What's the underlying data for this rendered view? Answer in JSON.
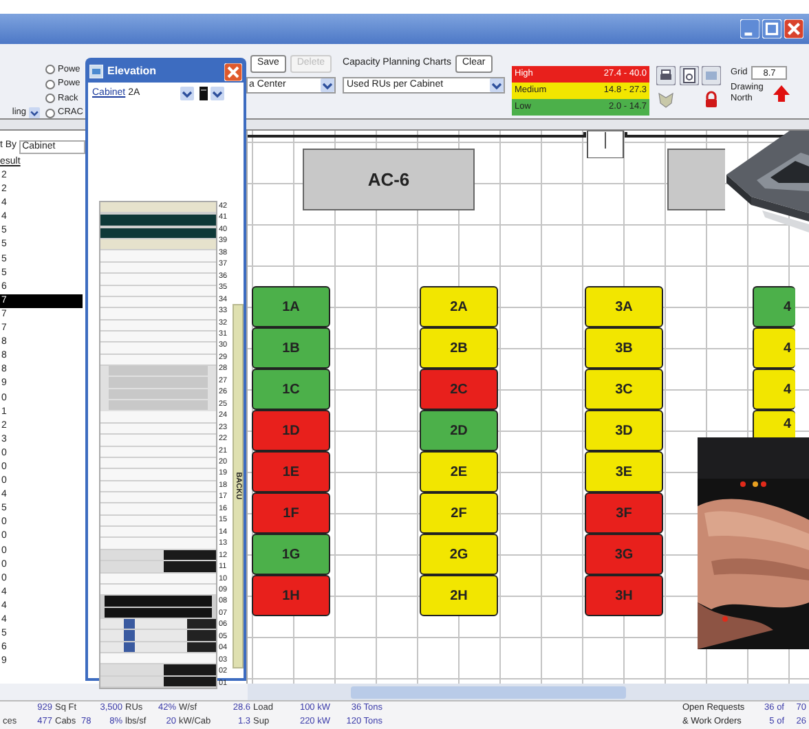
{
  "filters": {
    "radios": [
      {
        "label": "Powe",
        "selected": false
      },
      {
        "label": "Powe",
        "selected": false
      },
      {
        "label": "Rack",
        "selected": false
      },
      {
        "label": "CRAC",
        "selected": false
      }
    ],
    "dropdown_label": "ling",
    "sort_label": "t By",
    "sort_value": "Cabinet"
  },
  "result_list": {
    "header": "esult",
    "rows": [
      {
        "text": "2",
        "selected": false
      },
      {
        "text": "2",
        "selected": false
      },
      {
        "text": "4",
        "selected": false
      },
      {
        "text": "4",
        "selected": false
      },
      {
        "text": "5",
        "selected": false
      },
      {
        "text": "5",
        "selected": false
      },
      {
        "text": "5",
        "selected": false
      },
      {
        "text": "5",
        "selected": false
      },
      {
        "text": "6",
        "selected": false
      },
      {
        "text": "7",
        "selected": true
      },
      {
        "text": "7",
        "selected": false
      },
      {
        "text": "7",
        "selected": false
      },
      {
        "text": "8",
        "selected": false
      },
      {
        "text": "8",
        "selected": false
      },
      {
        "text": "8",
        "selected": false
      },
      {
        "text": "9",
        "selected": false
      },
      {
        "text": "0",
        "selected": false
      },
      {
        "text": "1",
        "selected": false
      },
      {
        "text": "2",
        "selected": false
      },
      {
        "text": "3",
        "selected": false
      },
      {
        "text": "0",
        "selected": false
      },
      {
        "text": "0",
        "selected": false
      },
      {
        "text": "0",
        "selected": false
      },
      {
        "text": "4",
        "selected": false
      },
      {
        "text": "5",
        "selected": false
      },
      {
        "text": "0",
        "selected": false
      },
      {
        "text": "0",
        "selected": false
      },
      {
        "text": "0",
        "selected": false
      },
      {
        "text": "0",
        "selected": false
      },
      {
        "text": "0",
        "selected": false
      },
      {
        "text": "4",
        "selected": false
      },
      {
        "text": "4",
        "selected": false
      },
      {
        "text": "4",
        "selected": false
      },
      {
        "text": "5",
        "selected": false
      },
      {
        "text": "6",
        "selected": false
      },
      {
        "text": "9",
        "selected": false
      }
    ]
  },
  "toolbar": {
    "save": "Save",
    "delete": {
      "label": "Delete",
      "disabled": true
    },
    "view_select": "a Center",
    "charts_label": "Capacity Planning Charts",
    "clear": "Clear",
    "chart_select": "Used RUs per Cabinet",
    "legend": [
      {
        "name": "High",
        "range": "27.4 - 40.0",
        "color": "#e8201c"
      },
      {
        "name": "Medium",
        "range": "14.8 - 27.3",
        "color": "#f2e600"
      },
      {
        "name": "Low",
        "range": "2.0 - 14.7",
        "color": "#4cb04a"
      }
    ],
    "grid_label": "Grid",
    "grid_value": "8.7",
    "north_label": "Drawing North"
  },
  "elevation": {
    "title": "Elevation",
    "cabinet_link": "Cabinet",
    "cabinet_value": "2A",
    "side_label": "BACKU",
    "units": [
      {
        "number": "42",
        "kind": "shelf"
      },
      {
        "number": "41",
        "kind": "patch"
      },
      {
        "number": "40",
        "kind": "patch"
      },
      {
        "number": "39",
        "kind": "shelf"
      },
      {
        "number": "38",
        "kind": "empty"
      },
      {
        "number": "37",
        "kind": "empty"
      },
      {
        "number": "36",
        "kind": "empty"
      },
      {
        "number": "35",
        "kind": "empty"
      },
      {
        "number": "34",
        "kind": "empty"
      },
      {
        "number": "33",
        "kind": "empty"
      },
      {
        "number": "32",
        "kind": "empty"
      },
      {
        "number": "31",
        "kind": "empty"
      },
      {
        "number": "30",
        "kind": "empty"
      },
      {
        "number": "29",
        "kind": "empty"
      },
      {
        "number": "28",
        "kind": "server"
      },
      {
        "number": "27",
        "kind": "server"
      },
      {
        "number": "26",
        "kind": "server"
      },
      {
        "number": "25",
        "kind": "server"
      },
      {
        "number": "24",
        "kind": "empty"
      },
      {
        "number": "23",
        "kind": "empty"
      },
      {
        "number": "22",
        "kind": "empty"
      },
      {
        "number": "21",
        "kind": "empty"
      },
      {
        "number": "20",
        "kind": "empty"
      },
      {
        "number": "19",
        "kind": "empty"
      },
      {
        "number": "18",
        "kind": "empty"
      },
      {
        "number": "17",
        "kind": "empty"
      },
      {
        "number": "16",
        "kind": "empty"
      },
      {
        "number": "15",
        "kind": "empty"
      },
      {
        "number": "14",
        "kind": "empty"
      },
      {
        "number": "13",
        "kind": "empty"
      },
      {
        "number": "12",
        "kind": "switch"
      },
      {
        "number": "11",
        "kind": "switch"
      },
      {
        "number": "10",
        "kind": "empty"
      },
      {
        "number": "09",
        "kind": "empty"
      },
      {
        "number": "08",
        "kind": "blade"
      },
      {
        "number": "07",
        "kind": "blade"
      },
      {
        "number": "06",
        "kind": "module"
      },
      {
        "number": "05",
        "kind": "module"
      },
      {
        "number": "04",
        "kind": "module"
      },
      {
        "number": "03",
        "kind": "empty"
      },
      {
        "number": "02",
        "kind": "switch"
      },
      {
        "number": "01",
        "kind": "switch"
      }
    ]
  },
  "floor_plan": {
    "ac_units": [
      {
        "label": "AC-6"
      },
      {
        "kind": "unlabeled"
      }
    ],
    "columns": [
      [
        {
          "label": "1A",
          "color": "#4cb04a"
        },
        {
          "label": "1B",
          "color": "#4cb04a"
        },
        {
          "label": "1C",
          "color": "#4cb04a"
        },
        {
          "label": "1D",
          "color": "#e8201c"
        },
        {
          "label": "1E",
          "color": "#e8201c"
        },
        {
          "label": "1F",
          "color": "#e8201c"
        },
        {
          "label": "1G",
          "color": "#4cb04a"
        },
        {
          "label": "1H",
          "color": "#e8201c"
        }
      ],
      [
        {
          "label": "2A",
          "color": "#f2e600"
        },
        {
          "label": "2B",
          "color": "#f2e600"
        },
        {
          "label": "2C",
          "color": "#e8201c"
        },
        {
          "label": "2D",
          "color": "#4cb04a"
        },
        {
          "label": "2E",
          "color": "#f2e600"
        },
        {
          "label": "2F",
          "color": "#f2e600"
        },
        {
          "label": "2G",
          "color": "#f2e600"
        },
        {
          "label": "2H",
          "color": "#f2e600"
        }
      ],
      [
        {
          "label": "3A",
          "color": "#f2e600"
        },
        {
          "label": "3B",
          "color": "#f2e600"
        },
        {
          "label": "3C",
          "color": "#f2e600"
        },
        {
          "label": "3D",
          "color": "#f2e600"
        },
        {
          "label": "3E",
          "color": "#f2e600"
        },
        {
          "label": "3F",
          "color": "#e8201c"
        },
        {
          "label": "3G",
          "color": "#e8201c"
        },
        {
          "label": "3H",
          "color": "#e8201c"
        }
      ],
      [
        {
          "label": "4",
          "color": "#4cb04a"
        },
        {
          "label": "4",
          "color": "#f2e600"
        },
        {
          "label": "4",
          "color": "#f2e600"
        },
        {
          "label": "4",
          "color": "#f2e600"
        }
      ]
    ]
  },
  "status_bar": {
    "rows": [
      [
        [
          {
            "text": "929",
            "kind": "value"
          }
        ],
        [
          {
            "text": "Sq Ft",
            "kind": "label"
          }
        ],
        [
          {
            "text": "3,500",
            "kind": "value"
          }
        ],
        [
          {
            "text": "RUs",
            "kind": "label"
          }
        ],
        [
          {
            "text": "42%",
            "kind": "value"
          }
        ],
        [
          {
            "text": "W/sf",
            "kind": "label"
          }
        ],
        [
          {
            "text": "28.6",
            "kind": "value"
          }
        ],
        [
          {
            "text": "Load",
            "kind": "label"
          }
        ],
        [
          {
            "text": "100 kW",
            "kind": "value"
          }
        ],
        [
          {
            "text": "36 Tons",
            "kind": "value"
          }
        ]
      ],
      [
        [
          {
            "text": "ces",
            "kind": "label"
          },
          {
            "text": "477",
            "kind": "value"
          }
        ],
        [
          {
            "text": "Cabs",
            "kind": "label"
          }
        ],
        [
          {
            "text": "78",
            "kind": "value"
          },
          {
            "text": "8%",
            "kind": "value"
          }
        ],
        [
          {
            "text": "lbs/sf",
            "kind": "label"
          }
        ],
        [
          {
            "text": "20",
            "kind": "value"
          }
        ],
        [
          {
            "text": "kW/Cab",
            "kind": "label"
          }
        ],
        [
          {
            "text": "1.3",
            "kind": "value"
          }
        ],
        [
          {
            "text": "Sup",
            "kind": "label"
          }
        ],
        [
          {
            "text": "220 kW",
            "kind": "value"
          }
        ],
        [
          {
            "text": "120 Tons",
            "kind": "value"
          }
        ]
      ]
    ],
    "requests": [
      {
        "label": "Open Requests",
        "count": "36 of",
        "total": "70"
      },
      {
        "label": "& Work Orders",
        "count": "5 of",
        "total": "26"
      }
    ]
  }
}
